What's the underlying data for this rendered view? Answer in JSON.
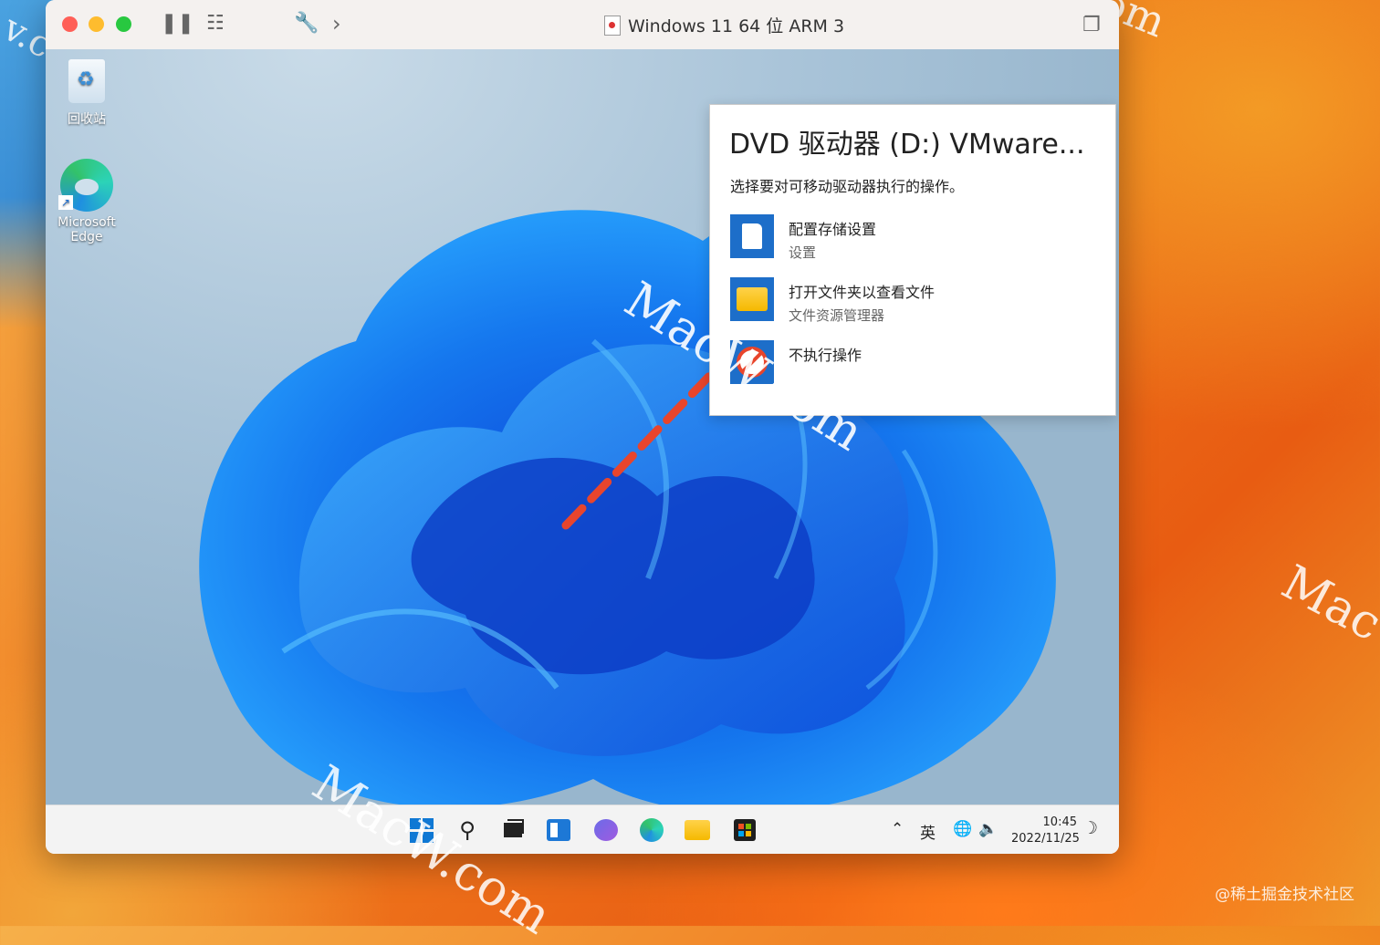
{
  "window": {
    "title": "Windows 11 64 位 ARM 3"
  },
  "desktop": {
    "icons": [
      {
        "label": "回收站"
      },
      {
        "label_line1": "Microsoft",
        "label_line2": "Edge"
      }
    ]
  },
  "autoplay": {
    "title": "DVD 驱动器 (D:) VMware...",
    "subtitle": "选择要对可移动驱动器执行的操作。",
    "actions": [
      {
        "label": "配置存储设置",
        "sub": "设置",
        "icon": "sd-card-icon"
      },
      {
        "label": "打开文件夹以查看文件",
        "sub": "文件资源管理器",
        "icon": "folder-icon"
      },
      {
        "label": "不执行操作",
        "sub": "",
        "icon": "no-action-icon"
      }
    ]
  },
  "taskbar": {
    "ime": "英",
    "time": "10:45",
    "date": "2022/11/25"
  },
  "watermarks": {
    "top_left": "v.com",
    "top_right": "om",
    "right": "Mac W",
    "center": "MacW.com",
    "bottom": "MacW.com"
  },
  "credit": "@稀土掘金技术社区",
  "colors": {
    "accent": "#1d6ec9",
    "arrow": "#e8452c"
  }
}
